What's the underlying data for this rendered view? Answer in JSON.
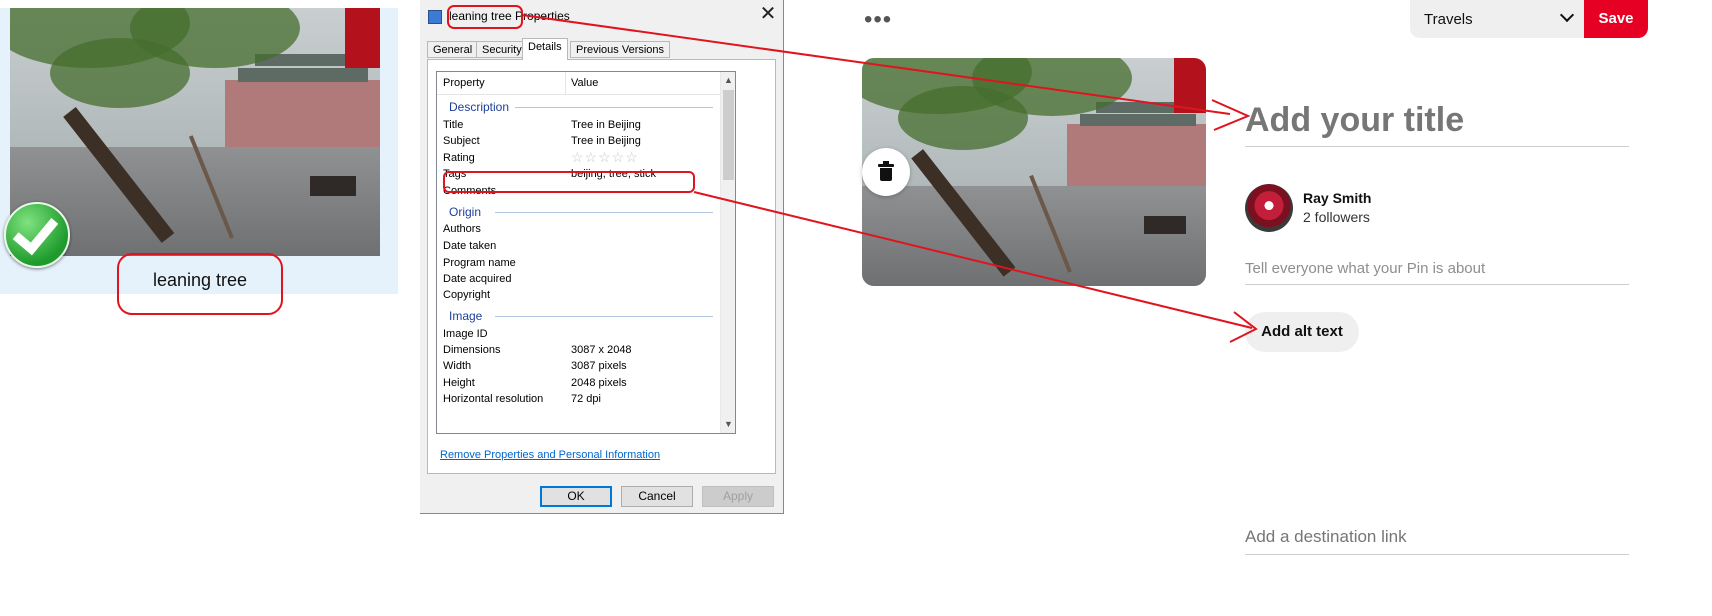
{
  "explorer": {
    "file_name": "leaning tree"
  },
  "dialog": {
    "title": "leaning tree Properties",
    "tabs": [
      {
        "label": "General"
      },
      {
        "label": "Security"
      },
      {
        "label": "Details"
      },
      {
        "label": "Previous Versions"
      }
    ],
    "active_tab": "Details",
    "columns": {
      "property": "Property",
      "value": "Value"
    },
    "groups": {
      "description": "Description",
      "origin": "Origin",
      "image": "Image"
    },
    "description_rows": [
      {
        "name": "Title",
        "value": "Tree in Beijing"
      },
      {
        "name": "Subject",
        "value": "Tree in Beijing"
      },
      {
        "name": "Rating",
        "value": "☆☆☆☆☆"
      },
      {
        "name": "Tags",
        "value": "beijing, tree, stick"
      },
      {
        "name": "Comments",
        "value": ""
      }
    ],
    "origin_rows": [
      {
        "name": "Authors"
      },
      {
        "name": "Date taken"
      },
      {
        "name": "Program name"
      },
      {
        "name": "Date acquired"
      },
      {
        "name": "Copyright"
      }
    ],
    "image_rows": [
      {
        "name": "Image ID",
        "value": ""
      },
      {
        "name": "Dimensions",
        "value": "3087 x 2048"
      },
      {
        "name": "Width",
        "value": "3087 pixels"
      },
      {
        "name": "Height",
        "value": "2048 pixels"
      },
      {
        "name": "Horizontal resolution",
        "value": "72 dpi"
      }
    ],
    "remove_link": "Remove Properties and Personal Information",
    "buttons": {
      "ok": "OK",
      "cancel": "Cancel",
      "apply": "Apply"
    },
    "close_glyph": "✕"
  },
  "pin": {
    "more_glyph": "•••",
    "board": "Travels",
    "save_label": "Save",
    "title_placeholder": "Add your title",
    "user": {
      "name": "Ray Smith",
      "followers": "2 followers"
    },
    "description_placeholder": "Tell everyone what your Pin is about",
    "alt_text_label": "Add alt text",
    "link_placeholder": "Add a destination link"
  },
  "colors": {
    "save_red": "#e60023",
    "annotation_red": "#e0141e",
    "explorer_selection": "#e5f1fb",
    "link_blue": "#0066cc"
  },
  "icons": {
    "check": "check-icon",
    "trash": "trash-icon",
    "close": "close-icon",
    "chevron": "chevron-down-icon",
    "more": "more-icon"
  }
}
